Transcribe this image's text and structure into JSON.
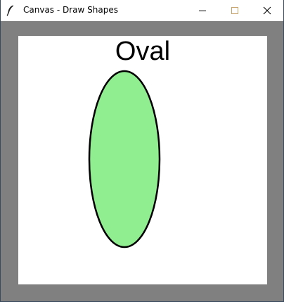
{
  "window": {
    "title": "Canvas - Draw Shapes",
    "icon": "feather-icon",
    "controls": {
      "minimize_icon": "minimize-icon",
      "maximize_icon": "maximize-icon",
      "close_icon": "close-icon"
    }
  },
  "canvas": {
    "background": "#ffffff",
    "label": "Oval",
    "shape": {
      "kind": "oval",
      "fill": "#90ee90",
      "outline": "#000000"
    }
  },
  "colors": {
    "window_background": "#808080",
    "maximize_accent": "#c7a36a"
  }
}
